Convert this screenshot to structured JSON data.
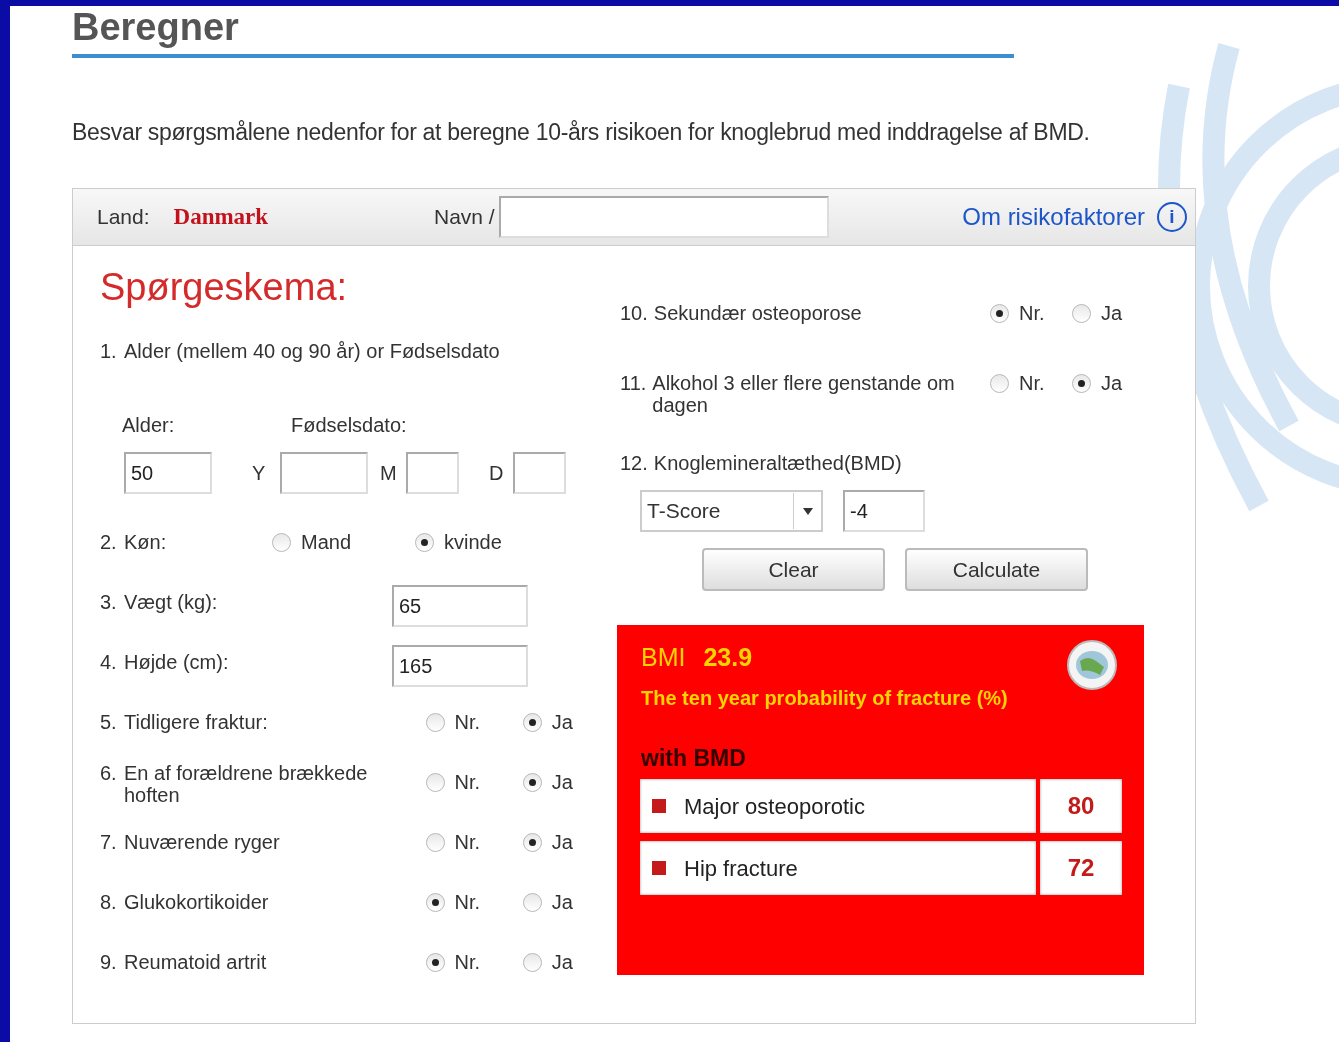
{
  "heading": "Beregner",
  "intro": "Besvar spørgsmålene nedenfor for at beregne 10-års risikoen for knoglebrud med inddragelse af BMD.",
  "header": {
    "country_label": "Land:",
    "country": "Danmark",
    "name_label": "Navn /",
    "about_link": "Om risikofaktorer",
    "info_icon": "i"
  },
  "title": "Spørgeskema:",
  "age": {
    "number": "1.",
    "label": "Alder (mellem 40 og 90 år) or Fødselsdato",
    "age_label": "Alder:",
    "age_value": "50",
    "birth_label": "Fødselsdato:",
    "year_label": "Y",
    "month_label": "M",
    "day_label": "D"
  },
  "left_questions": [
    {
      "kind": "radio",
      "number": "2.",
      "label": "Køn:",
      "options": [
        {
          "label": "Mand",
          "selected": false
        },
        {
          "label": "kvinde",
          "selected": true
        }
      ]
    },
    {
      "kind": "input",
      "number": "3.",
      "label": "Vægt (kg):",
      "value": "65"
    },
    {
      "kind": "input",
      "number": "4.",
      "label": "Højde (cm):",
      "value": "165"
    },
    {
      "kind": "radio",
      "number": "5.",
      "label": "Tidligere fraktur:",
      "options": [
        {
          "label": "Nr.",
          "selected": false
        },
        {
          "label": "Ja",
          "selected": true
        }
      ]
    },
    {
      "kind": "radio",
      "number": "6.",
      "label": "En af forældrene brækkede hoften",
      "options": [
        {
          "label": "Nr.",
          "selected": false
        },
        {
          "label": "Ja",
          "selected": true
        }
      ]
    },
    {
      "kind": "radio",
      "number": "7.",
      "label": "Nuværende ryger",
      "options": [
        {
          "label": "Nr.",
          "selected": false
        },
        {
          "label": "Ja",
          "selected": true
        }
      ]
    },
    {
      "kind": "radio",
      "number": "8.",
      "label": "Glukokortikoider",
      "options": [
        {
          "label": "Nr.",
          "selected": true
        },
        {
          "label": "Ja",
          "selected": false
        }
      ]
    },
    {
      "kind": "radio",
      "number": "9.",
      "label": "Reumatoid artrit",
      "options": [
        {
          "label": "Nr.",
          "selected": true
        },
        {
          "label": "Ja",
          "selected": false
        }
      ]
    }
  ],
  "right_questions": [
    {
      "number": "10.",
      "label": "Sekundær osteoporose",
      "options": [
        {
          "label": "Nr.",
          "selected": true
        },
        {
          "label": "Ja",
          "selected": false
        }
      ]
    },
    {
      "number": "11.",
      "label": "Alkohol 3 eller flere genstande om dagen",
      "options": [
        {
          "label": "Nr.",
          "selected": false
        },
        {
          "label": "Ja",
          "selected": true
        }
      ]
    }
  ],
  "bmd": {
    "number": "12.",
    "label": "Knoglemineraltæthed(BMD)",
    "select": "T-Score",
    "value": "-4"
  },
  "buttons": [
    "Clear",
    "Calculate"
  ],
  "result": {
    "bmi_label": "BMI",
    "bmi": "23.9",
    "subtitle": "The ten year probability of fracture (%)",
    "section": "with BMD",
    "rows": [
      {
        "label": "Major osteoporotic",
        "value": "80"
      },
      {
        "label": "Hip fracture",
        "value": "72"
      }
    ]
  }
}
